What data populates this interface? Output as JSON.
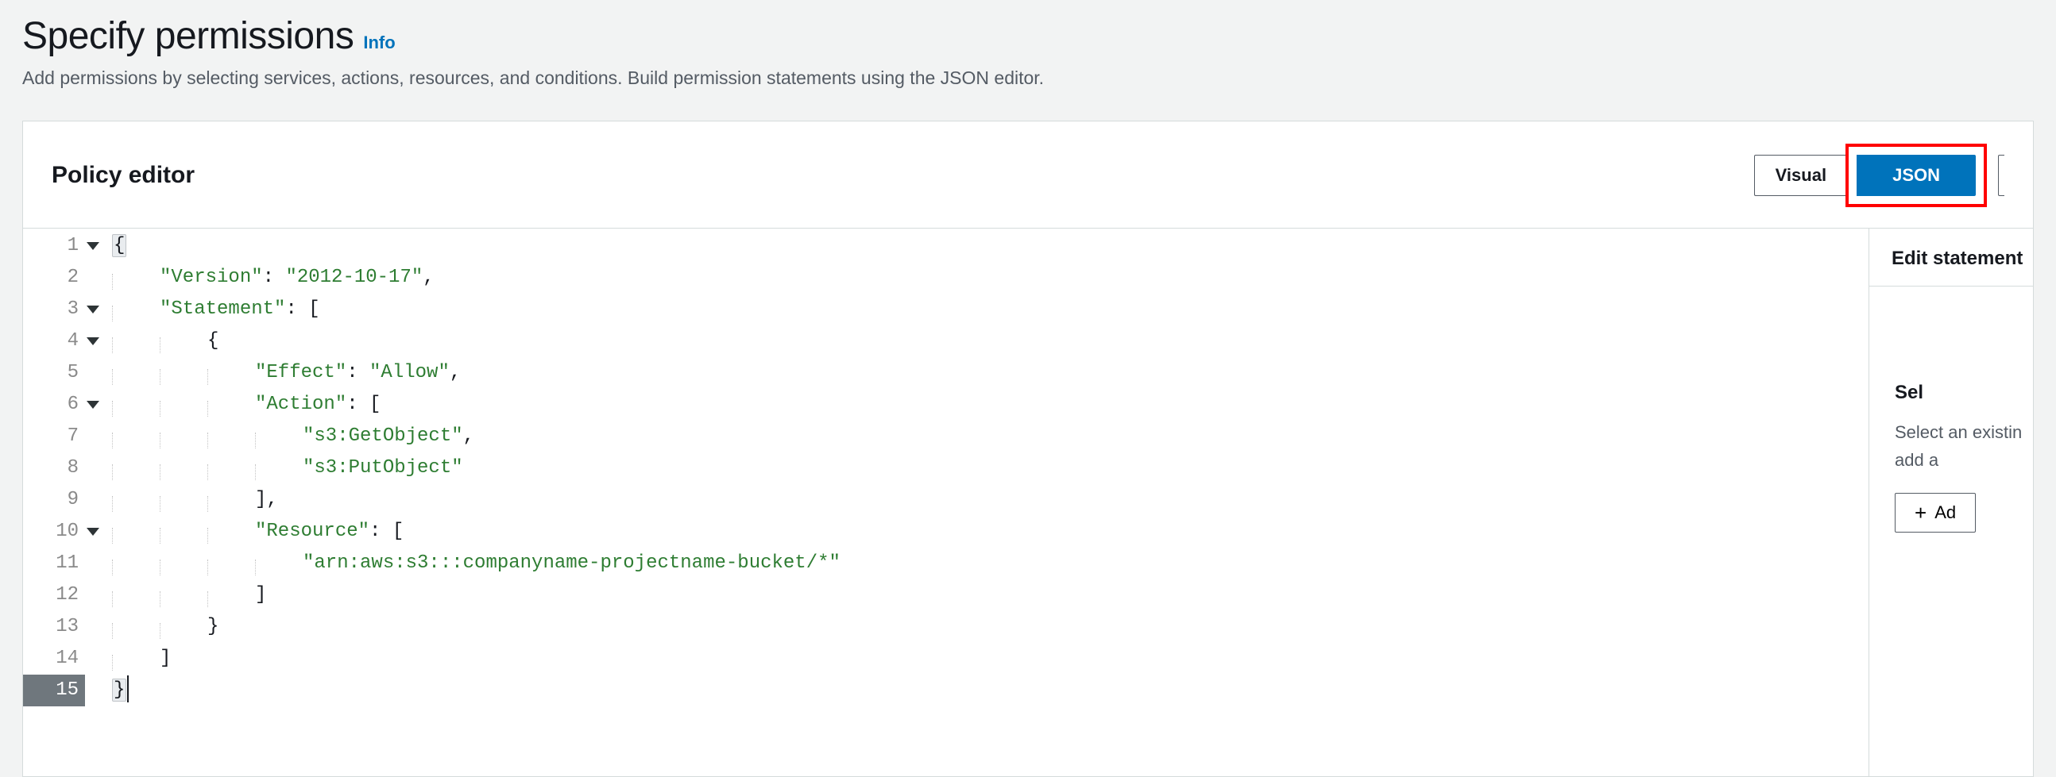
{
  "header": {
    "title": "Specify permissions",
    "info_label": "Info",
    "subtitle": "Add permissions by selecting services, actions, resources, and conditions. Build permission statements using the JSON editor."
  },
  "panel": {
    "title": "Policy editor",
    "tabs": {
      "visual": "Visual",
      "json": "JSON"
    }
  },
  "code": {
    "line_numbers": [
      "1",
      "2",
      "3",
      "4",
      "5",
      "6",
      "7",
      "8",
      "9",
      "10",
      "11",
      "12",
      "13",
      "14",
      "15"
    ],
    "tokens": {
      "l1_brace": "{",
      "l2_key": "\"Version\"",
      "l2_colon": ": ",
      "l2_val": "\"2012-10-17\"",
      "l2_comma": ",",
      "l3_key": "\"Statement\"",
      "l3_colon": ": [",
      "l4_brace": "{",
      "l5_key": "\"Effect\"",
      "l5_colon": ": ",
      "l5_val": "\"Allow\"",
      "l5_comma": ",",
      "l6_key": "\"Action\"",
      "l6_colon": ": [",
      "l7_val": "\"s3:GetObject\"",
      "l7_comma": ",",
      "l8_val": "\"s3:PutObject\"",
      "l9_close": "],",
      "l10_key": "\"Resource\"",
      "l10_colon": ": [",
      "l11_val": "\"arn:aws:s3:::companyname-projectname-bucket/*\"",
      "l12_close": "]",
      "l13_close": "}",
      "l14_close": "]",
      "l15_close": "}"
    }
  },
  "sidebar": {
    "title": "Edit statement",
    "select_heading": "Sel",
    "select_desc_l1": "Select an existin",
    "select_desc_l2": "add a",
    "add_label": "Ad"
  }
}
